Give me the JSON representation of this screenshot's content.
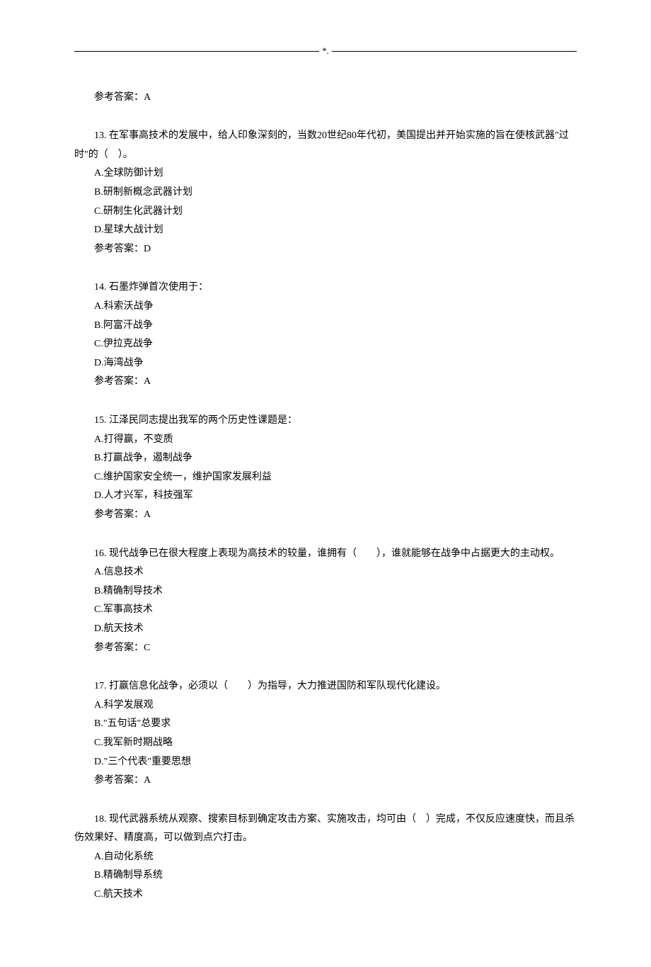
{
  "header": {
    "mark": "*."
  },
  "ans_prefix": "参考答案：",
  "q12": {
    "answer": "A"
  },
  "q13": {
    "stem": "13. 在军事高技术的发展中，给人印象深刻的，当数20世纪80年代初，美国提出并开始实施的旨在使核武器\"过时\"的（　）。",
    "opts": {
      "a": "A.全球防御计划",
      "b": "B.研制新概念武器计划",
      "c": "C.研制生化武器计划",
      "d": "D.星球大战计划"
    },
    "answer": "D"
  },
  "q14": {
    "stem": "14. 石墨炸弹首次使用于：",
    "opts": {
      "a": "A.科索沃战争",
      "b": "B.阿富汗战争",
      "c": "C.伊拉克战争",
      "d": "D.海湾战争"
    },
    "answer": "A"
  },
  "q15": {
    "stem": "15. 江泽民同志提出我军的两个历史性课题是：",
    "opts": {
      "a": "A.打得赢，不变质",
      "b": "B.打赢战争，遏制战争",
      "c": "C.维护国家安全统一，维护国家发展利益",
      "d": "D.人才兴军，科技强军"
    },
    "answer": "A"
  },
  "q16": {
    "stem": "16. 现代战争已在很大程度上表现为高技术的较量，谁拥有（　　），谁就能够在战争中占据更大的主动权。",
    "opts": {
      "a": "A.信息技术",
      "b": "B.精确制导技术",
      "c": "C.军事高技术",
      "d": "D.航天技术"
    },
    "answer": "C"
  },
  "q17": {
    "stem": "17. 打赢信息化战争，必须以（　　）为指导，大力推进国防和军队现代化建设。",
    "opts": {
      "a": "A.科学发展观",
      "b": "B.\"五句话\"总要求",
      "c": "C.我军新时期战略",
      "d": "D.\"三个代表\"重要思想"
    },
    "answer": "A"
  },
  "q18": {
    "stem": "18. 现代武器系统从观察、搜索目标到确定攻击方案、实施攻击，均可由（　）完成，不仅反应速度快，而且杀伤效果好、精度高，可以做到点穴打击。",
    "opts": {
      "a": "A.自动化系统",
      "b": "B.精确制导系统",
      "c": "C.航天技术"
    }
  }
}
